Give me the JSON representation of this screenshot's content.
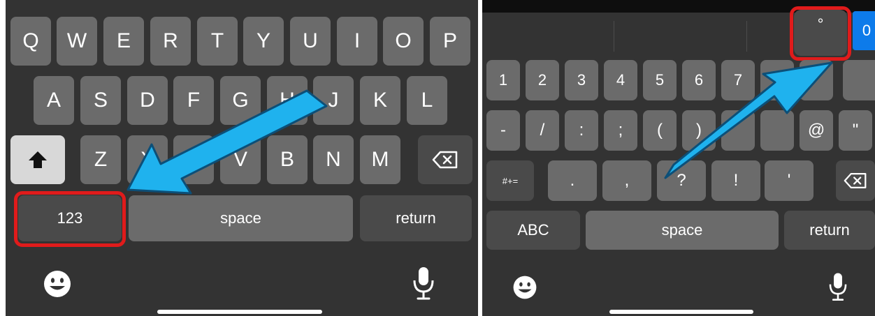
{
  "left": {
    "rows": {
      "row1": [
        "Q",
        "W",
        "E",
        "R",
        "T",
        "Y",
        "U",
        "I",
        "O",
        "P"
      ],
      "row2": [
        "A",
        "S",
        "D",
        "F",
        "G",
        "H",
        "J",
        "K",
        "L"
      ],
      "row3": [
        "Z",
        "X",
        "C",
        "V",
        "B",
        "N",
        "M"
      ]
    },
    "numbers_label": "123",
    "space_label": "space",
    "return_label": "return"
  },
  "right": {
    "suggestion_degree": "°",
    "suggestion_zero": "0",
    "row1": [
      "1",
      "2",
      "3",
      "4",
      "5",
      "6",
      "7"
    ],
    "row2": [
      "-",
      "/",
      ":",
      ";",
      "(",
      ")",
      "@",
      "\""
    ],
    "row3": [
      ".",
      ",",
      "?",
      "!",
      "'"
    ],
    "symbols_label": "#+=",
    "abc_label": "ABC",
    "space_label": "space",
    "return_label": "return"
  },
  "colors": {
    "arrow": "#1fb2ee",
    "highlight": "#e01b1b"
  },
  "icons": [
    "shift-icon",
    "backspace-icon",
    "emoji-icon",
    "microphone-icon"
  ]
}
